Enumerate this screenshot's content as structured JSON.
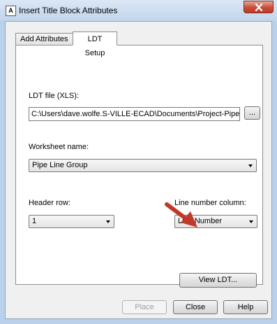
{
  "window": {
    "title": "Insert Title Block Attributes",
    "icon_letter": "A"
  },
  "tabs": [
    {
      "label": "Add Attributes",
      "active": false
    },
    {
      "label": "LDT Setup",
      "active": true
    }
  ],
  "ldt_file": {
    "label": "LDT file (XLS):",
    "value": "C:\\Users\\dave.wolfe.S-VILLE-ECAD\\Documents\\Project-Pipe Line",
    "browse_label": "..."
  },
  "worksheet": {
    "label": "Worksheet name:",
    "value": "Pipe Line Group"
  },
  "header_row": {
    "label": "Header row:",
    "value": "1"
  },
  "line_number_column": {
    "label": "Line number column:",
    "value": "Line Number"
  },
  "view_ldt_label": "View LDT...",
  "footer": {
    "place_label": "Place",
    "close_label": "Close",
    "help_label": "Help"
  },
  "colors": {
    "arrow": "#c0392b",
    "close_button": "#c74d36"
  }
}
